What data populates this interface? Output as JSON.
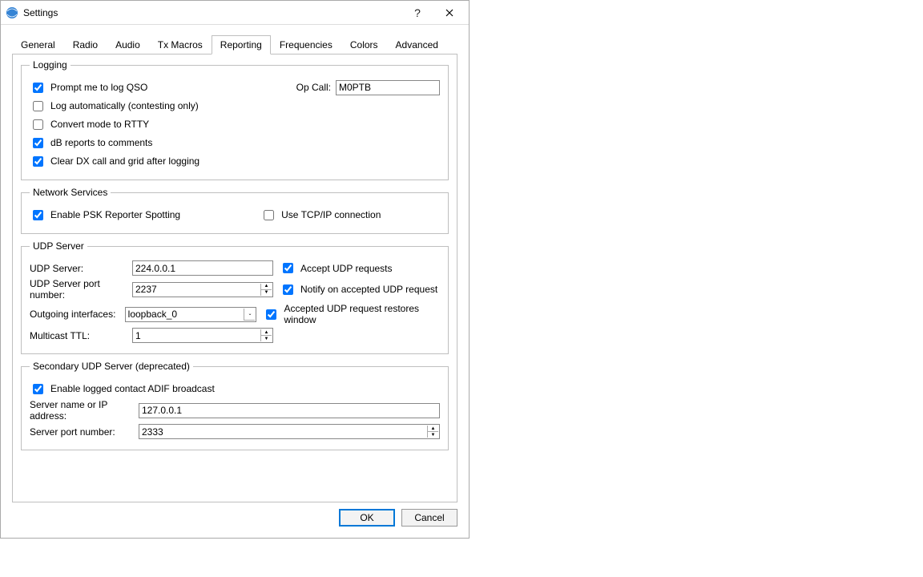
{
  "window": {
    "title": "Settings"
  },
  "tabs": {
    "general": "General",
    "radio": "Radio",
    "audio": "Audio",
    "txmacros": "Tx Macros",
    "reporting": "Reporting",
    "frequencies": "Frequencies",
    "colors": "Colors",
    "advanced": "Advanced"
  },
  "logging": {
    "legend": "Logging",
    "prompt": "Prompt me to log QSO",
    "opcall_label": "Op Call:",
    "opcall_value": "M0PTB",
    "auto": "Log automatically (contesting only)",
    "convert": "Convert mode to RTTY",
    "dbreports": "dB reports to comments",
    "cleardx": "Clear DX call and grid after logging"
  },
  "network": {
    "legend": "Network Services",
    "psk": "Enable PSK Reporter Spotting",
    "tcp": "Use TCP/IP connection"
  },
  "udp": {
    "legend": "UDP Server",
    "server_label": "UDP Server:",
    "server_value": "224.0.0.1",
    "port_label": "UDP Server port number:",
    "port_value": "2237",
    "out_label": "Outgoing interfaces:",
    "out_value": "loopback_0",
    "ttl_label": "Multicast TTL:",
    "ttl_value": "1",
    "accept": "Accept UDP requests",
    "notify": "Notify on accepted UDP request",
    "restore": "Accepted UDP request restores window"
  },
  "secudp": {
    "legend": "Secondary UDP Server (deprecated)",
    "enable": "Enable logged contact ADIF broadcast",
    "name_label": "Server name or IP address:",
    "name_value": "127.0.0.1",
    "port_label": "Server port number:",
    "port_value": "2333"
  },
  "buttons": {
    "ok": "OK",
    "cancel": "Cancel"
  }
}
